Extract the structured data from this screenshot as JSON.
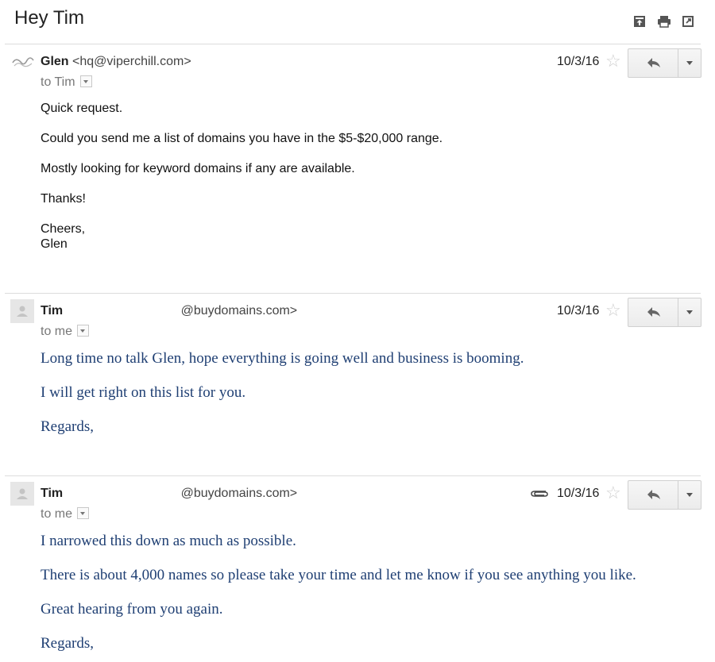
{
  "thread": {
    "subject": "Hey Tim",
    "toolbar_icons": [
      "archive-icon",
      "print-icon",
      "open-new-window-icon"
    ]
  },
  "messages": [
    {
      "sender_name": "Glen",
      "sender_email": "<hq@viperchill.com>",
      "to_line": "to Tim",
      "date": "10/3/16",
      "has_attachment": false,
      "body": [
        "Quick request.",
        "Could you send me a list of domains you have in the $5-$20,000 range.",
        "Mostly looking for keyword domains if any are available.",
        "Thanks!",
        "Cheers,",
        "Glen"
      ]
    },
    {
      "sender_name": "Tim",
      "sender_email": "@buydomains.com>",
      "to_line": "to me",
      "date": "10/3/16",
      "has_attachment": false,
      "body": [
        "Long time no talk Glen, hope everything is going well and business is booming.",
        "I will get right on this list for you.",
        "Regards,"
      ]
    },
    {
      "sender_name": "Tim",
      "sender_email": "@buydomains.com>",
      "to_line": "to me",
      "date": "10/3/16",
      "has_attachment": true,
      "body": [
        "I narrowed this down as much as possible.",
        "There is about 4,000 names so please take your time and let me know if you see anything you like.",
        "Great hearing from you again.",
        "Regards,"
      ]
    }
  ],
  "icons": {
    "star": "☆"
  }
}
